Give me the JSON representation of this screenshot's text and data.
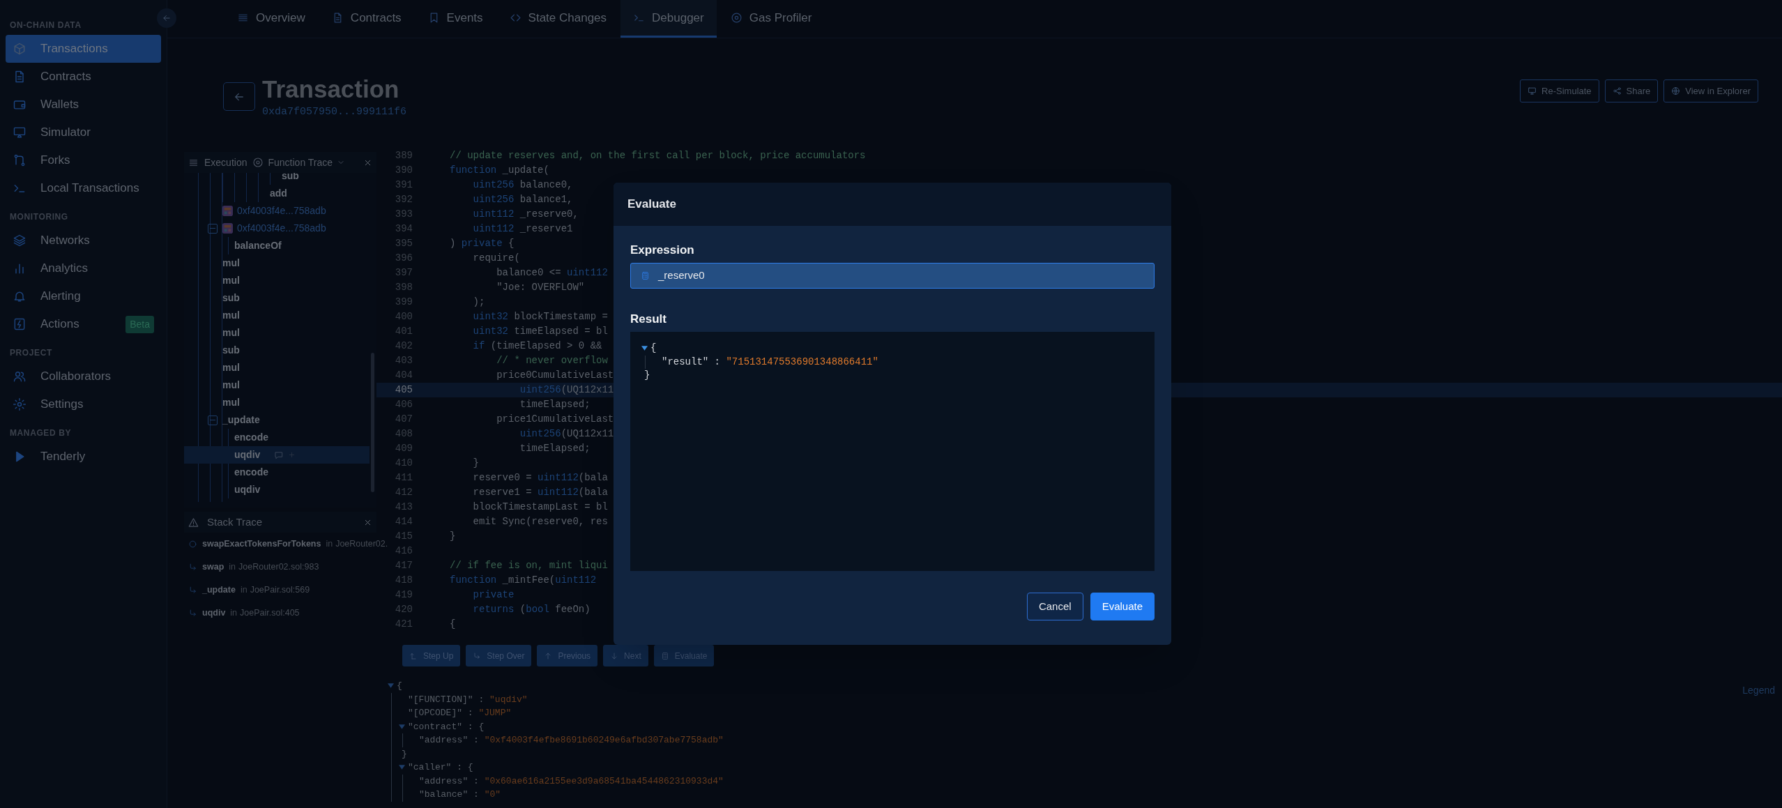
{
  "sidebar": {
    "sections": [
      {
        "title": "ON-CHAIN DATA",
        "items": [
          {
            "label": "Transactions",
            "selected": true
          },
          {
            "label": "Contracts",
            "selected": false
          },
          {
            "label": "Wallets",
            "selected": false
          },
          {
            "label": "Simulator",
            "selected": false
          },
          {
            "label": "Forks",
            "selected": false
          },
          {
            "label": "Local Transactions",
            "selected": false
          }
        ]
      },
      {
        "title": "MONITORING",
        "items": [
          {
            "label": "Networks",
            "selected": false
          },
          {
            "label": "Analytics",
            "selected": false
          },
          {
            "label": "Alerting",
            "selected": false
          },
          {
            "label": "Actions",
            "selected": false,
            "badge": "Beta"
          }
        ]
      },
      {
        "title": "PROJECT",
        "items": [
          {
            "label": "Collaborators",
            "selected": false
          },
          {
            "label": "Settings",
            "selected": false
          }
        ]
      },
      {
        "title": "MANAGED BY",
        "items": [
          {
            "label": "Tenderly",
            "selected": false
          }
        ]
      }
    ]
  },
  "tabs": [
    {
      "label": "Overview",
      "selected": false
    },
    {
      "label": "Contracts",
      "selected": false
    },
    {
      "label": "Events",
      "selected": false
    },
    {
      "label": "State Changes",
      "selected": false
    },
    {
      "label": "Debugger",
      "selected": true
    },
    {
      "label": "Gas Profiler",
      "selected": false
    }
  ],
  "header": {
    "title": "Transaction",
    "hash": "0xda7f057950...999111f6",
    "actions": [
      "Re-Simulate",
      "Share",
      "View in Explorer"
    ]
  },
  "execution_panel": {
    "title": "Execution",
    "mode": "Function Trace",
    "tree": [
      {
        "children": [
          {
            "children": [
              {
                "children": [
                  {
                    "children": [
                      {
                        "children": [
                          {
                            "label": "sub",
                            "kind": "call",
                            "selected": false
                          }
                        ]
                      },
                      {
                        "label": "add",
                        "kind": "call",
                        "selected": false
                      }
                    ]
                  }
                ]
              }
            ]
          }
        ]
      },
      {
        "label": "0xf4003f4e...758adb",
        "kind": "contract",
        "selected": false
      },
      {
        "label": "0xf4003f4e...758adb",
        "kind": "contract",
        "selected": false,
        "expanded": true,
        "children": [
          {
            "label": "balanceOf",
            "kind": "call",
            "selected": false
          }
        ]
      },
      {
        "label": "mul",
        "kind": "call",
        "selected": false
      },
      {
        "label": "mul",
        "kind": "call",
        "selected": false
      },
      {
        "label": "sub",
        "kind": "call",
        "selected": false
      },
      {
        "label": "mul",
        "kind": "call",
        "selected": false
      },
      {
        "label": "mul",
        "kind": "call",
        "selected": false
      },
      {
        "label": "sub",
        "kind": "call",
        "selected": false
      },
      {
        "label": "mul",
        "kind": "call",
        "selected": false
      },
      {
        "label": "mul",
        "kind": "call",
        "selected": false
      },
      {
        "label": "mul",
        "kind": "call",
        "selected": false
      },
      {
        "label": "_update",
        "kind": "call",
        "selected": false,
        "expanded": true,
        "children": [
          {
            "label": "encode",
            "kind": "call",
            "selected": false
          },
          {
            "label": "uqdiv",
            "kind": "call",
            "selected": true
          },
          {
            "label": "encode",
            "kind": "call",
            "selected": false
          },
          {
            "label": "uqdiv",
            "kind": "call",
            "selected": false
          }
        ]
      }
    ]
  },
  "stack_trace": {
    "title": "Stack Trace",
    "frames": [
      {
        "kind": "current",
        "function": "swapExactTokensForTokens",
        "preposition": "in",
        "location": "JoeRouter02."
      },
      {
        "kind": "frame",
        "function": "swap",
        "preposition": "in",
        "location": "JoeRouter02.sol:983"
      },
      {
        "kind": "frame",
        "function": "_update",
        "preposition": "in",
        "location": "JoePair.sol:569"
      },
      {
        "kind": "frame",
        "function": "uqdiv",
        "preposition": "in",
        "location": "JoePair.sol:405"
      }
    ]
  },
  "code": {
    "lines": [
      {
        "number": "389",
        "current": false,
        "segments": [
          {
            "text": "// update reserves and, on the first call per block, price accumulators",
            "kind": "comment"
          }
        ]
      },
      {
        "number": "390",
        "current": false,
        "segments": [
          {
            "text": "function",
            "kind": "keyword"
          },
          {
            "text": " _update(",
            "kind": "plain"
          }
        ]
      },
      {
        "number": "391",
        "current": false,
        "segments": [
          {
            "text": "    uint256",
            "kind": "type"
          },
          {
            "text": " balance0,",
            "kind": "plain"
          }
        ]
      },
      {
        "number": "392",
        "current": false,
        "segments": [
          {
            "text": "    uint256",
            "kind": "type"
          },
          {
            "text": " balance1,",
            "kind": "plain"
          }
        ]
      },
      {
        "number": "393",
        "current": false,
        "segments": [
          {
            "text": "    uint112",
            "kind": "type"
          },
          {
            "text": " _reserve0,",
            "kind": "plain"
          }
        ]
      },
      {
        "number": "394",
        "current": false,
        "segments": [
          {
            "text": "    uint112",
            "kind": "type"
          },
          {
            "text": " _reserve1",
            "kind": "plain"
          }
        ]
      },
      {
        "number": "395",
        "current": false,
        "segments": [
          {
            "text": ") ",
            "kind": "plain"
          },
          {
            "text": "private",
            "kind": "keyword"
          },
          {
            "text": " {",
            "kind": "plain"
          }
        ]
      },
      {
        "number": "396",
        "current": false,
        "segments": [
          {
            "text": "    require(",
            "kind": "plain"
          }
        ]
      },
      {
        "number": "397",
        "current": false,
        "segments": [
          {
            "text": "        balance0 <= ",
            "kind": "plain"
          },
          {
            "text": "uint112",
            "kind": "type"
          }
        ]
      },
      {
        "number": "398",
        "current": false,
        "segments": [
          {
            "text": "        \"Joe: OVERFLOW\"",
            "kind": "string"
          }
        ]
      },
      {
        "number": "399",
        "current": false,
        "segments": [
          {
            "text": "    );",
            "kind": "plain"
          }
        ]
      },
      {
        "number": "400",
        "current": false,
        "segments": [
          {
            "text": "    uint32",
            "kind": "type"
          },
          {
            "text": " blockTimestamp =",
            "kind": "plain"
          }
        ]
      },
      {
        "number": "401",
        "current": false,
        "segments": [
          {
            "text": "    uint32",
            "kind": "type"
          },
          {
            "text": " timeElapsed = bl",
            "kind": "plain"
          }
        ]
      },
      {
        "number": "402",
        "current": false,
        "segments": [
          {
            "text": "    if",
            "kind": "keyword"
          },
          {
            "text": " (timeElapsed > 0 &&",
            "kind": "plain"
          }
        ]
      },
      {
        "number": "403",
        "current": false,
        "segments": [
          {
            "text": "        // * never overflow",
            "kind": "comment"
          }
        ]
      },
      {
        "number": "404",
        "current": false,
        "segments": [
          {
            "text": "        price0CumulativeLast",
            "kind": "plain"
          }
        ]
      },
      {
        "number": "405",
        "current": true,
        "segments": [
          {
            "text": "            uint256",
            "kind": "type"
          },
          {
            "text": "(UQ112x11",
            "kind": "plain"
          }
        ]
      },
      {
        "number": "406",
        "current": false,
        "segments": [
          {
            "text": "            timeElapsed;",
            "kind": "plain"
          }
        ]
      },
      {
        "number": "407",
        "current": false,
        "segments": [
          {
            "text": "        price1CumulativeLast",
            "kind": "plain"
          }
        ]
      },
      {
        "number": "408",
        "current": false,
        "segments": [
          {
            "text": "            uint256",
            "kind": "type"
          },
          {
            "text": "(UQ112x11",
            "kind": "plain"
          }
        ]
      },
      {
        "number": "409",
        "current": false,
        "segments": [
          {
            "text": "            timeElapsed;",
            "kind": "plain"
          }
        ]
      },
      {
        "number": "410",
        "current": false,
        "segments": [
          {
            "text": "    }",
            "kind": "plain"
          }
        ]
      },
      {
        "number": "411",
        "current": false,
        "segments": [
          {
            "text": "    reserve0 = ",
            "kind": "plain"
          },
          {
            "text": "uint112",
            "kind": "type"
          },
          {
            "text": "(bala",
            "kind": "plain"
          }
        ]
      },
      {
        "number": "412",
        "current": false,
        "segments": [
          {
            "text": "    reserve1 = ",
            "kind": "plain"
          },
          {
            "text": "uint112",
            "kind": "type"
          },
          {
            "text": "(bala",
            "kind": "plain"
          }
        ]
      },
      {
        "number": "413",
        "current": false,
        "segments": [
          {
            "text": "    blockTimestampLast = bl",
            "kind": "plain"
          }
        ]
      },
      {
        "number": "414",
        "current": false,
        "segments": [
          {
            "text": "    emit Sync(reserve0, res",
            "kind": "plain"
          }
        ]
      },
      {
        "number": "415",
        "current": false,
        "segments": [
          {
            "text": "}",
            "kind": "plain"
          }
        ]
      },
      {
        "number": "416",
        "current": false
      },
      {
        "number": "417",
        "current": false,
        "segments": [
          {
            "text": "// if fee is on, mint liqui",
            "kind": "comment"
          }
        ]
      },
      {
        "number": "418",
        "current": false,
        "segments": [
          {
            "text": "function",
            "kind": "keyword"
          },
          {
            "text": " _mintFee(",
            "kind": "plain"
          },
          {
            "text": "uint112",
            "kind": "type"
          }
        ]
      },
      {
        "number": "419",
        "current": false,
        "segments": [
          {
            "text": "    private",
            "kind": "keyword"
          }
        ]
      },
      {
        "number": "420",
        "current": false,
        "segments": [
          {
            "text": "    returns",
            "kind": "keyword"
          },
          {
            "text": " (",
            "kind": "plain"
          },
          {
            "text": "bool",
            "kind": "type"
          },
          {
            "text": " feeOn)",
            "kind": "plain"
          }
        ]
      },
      {
        "number": "421",
        "current": false,
        "segments": [
          {
            "text": "{",
            "kind": "plain"
          }
        ]
      }
    ]
  },
  "debug_toolbar": [
    "Step Up",
    "Step Over",
    "Previous",
    "Next",
    "Evaluate"
  ],
  "state": {
    "legend": "Legend",
    "tree": {
      "open": "{",
      "expanded": true,
      "children": [
        {
          "key": "\"[FUNCTION]\"",
          "sep": " : ",
          "value": "\"uqdiv\""
        },
        {
          "key": "\"[OPCODE]\"",
          "sep": " : ",
          "value": "\"JUMP\""
        },
        {
          "key": "\"contract\"",
          "sep": " : ",
          "open": "{",
          "expanded": true,
          "close": "}",
          "children": [
            {
              "key": "\"address\"",
              "sep": " : ",
              "value": "\"0xf4003f4efbe8691b60249e6afbd307abe7758adb\""
            }
          ]
        },
        {
          "key": "\"caller\"",
          "sep": " : ",
          "open": "{",
          "expanded": true,
          "children": [
            {
              "key": "\"address\"",
              "sep": " : ",
              "value": "\"0x60ae616a2155ee3d9a68541ba4544862310933d4\""
            },
            {
              "key": "\"balance\"",
              "sep": " : ",
              "value": "\"0\""
            }
          ]
        }
      ]
    }
  },
  "modal": {
    "title": "Evaluate",
    "expression_label": "Expression",
    "expression": "_reserve0",
    "result_label": "Result",
    "result": {
      "open": "{",
      "expanded": true,
      "close": "}",
      "children": [
        {
          "key": "\"result\"",
          "sep": " : ",
          "value": "\"715131475536901348866411\""
        }
      ]
    },
    "buttons": [
      {
        "label": "Cancel",
        "kind": "secondary"
      },
      {
        "label": "Evaluate",
        "kind": "primary"
      }
    ]
  }
}
